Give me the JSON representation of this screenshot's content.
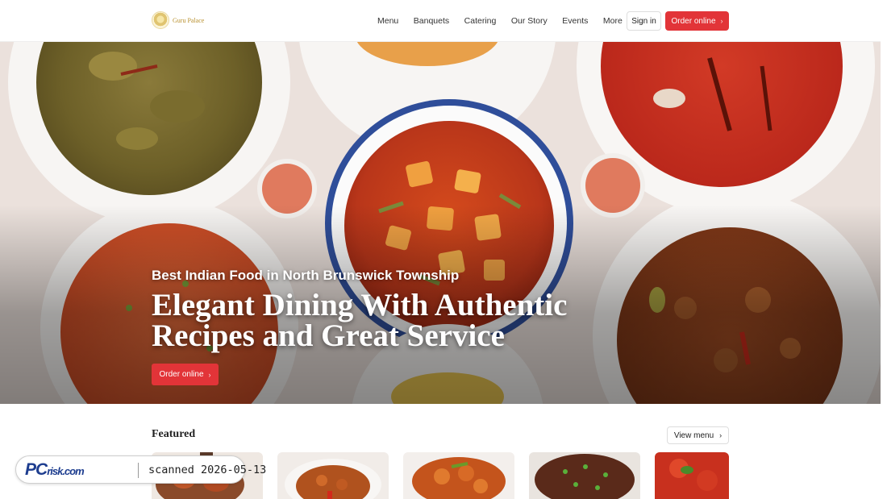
{
  "header": {
    "brand": "Guru Palace",
    "nav": [
      {
        "label": "Menu"
      },
      {
        "label": "Banquets"
      },
      {
        "label": "Catering"
      },
      {
        "label": "Our Story"
      },
      {
        "label": "Events"
      },
      {
        "label": "More",
        "icon": "chevron-down-icon"
      }
    ],
    "sign_in_label": "Sign in",
    "order_online_label": "Order online"
  },
  "hero": {
    "subtitle": "Best Indian Food in North Brunswick Township",
    "title": "Elegant Dining With Authentic Recipes and Great Service",
    "cta_label": "Order online"
  },
  "featured": {
    "title": "Featured",
    "view_menu_label": "View menu",
    "items": [
      {
        "image": "featured-dish-1"
      },
      {
        "image": "featured-dish-2"
      },
      {
        "image": "featured-dish-3"
      },
      {
        "image": "featured-dish-4"
      },
      {
        "image": "featured-dish-5"
      }
    ]
  },
  "scan_badge": {
    "brand": "PC",
    "brand_suffix": "risk.com",
    "text": "scanned 2026-05-13"
  },
  "colors": {
    "accent": "#e23438",
    "brand_gold": "#b8902e",
    "badge_blue": "#1d3d8f"
  }
}
